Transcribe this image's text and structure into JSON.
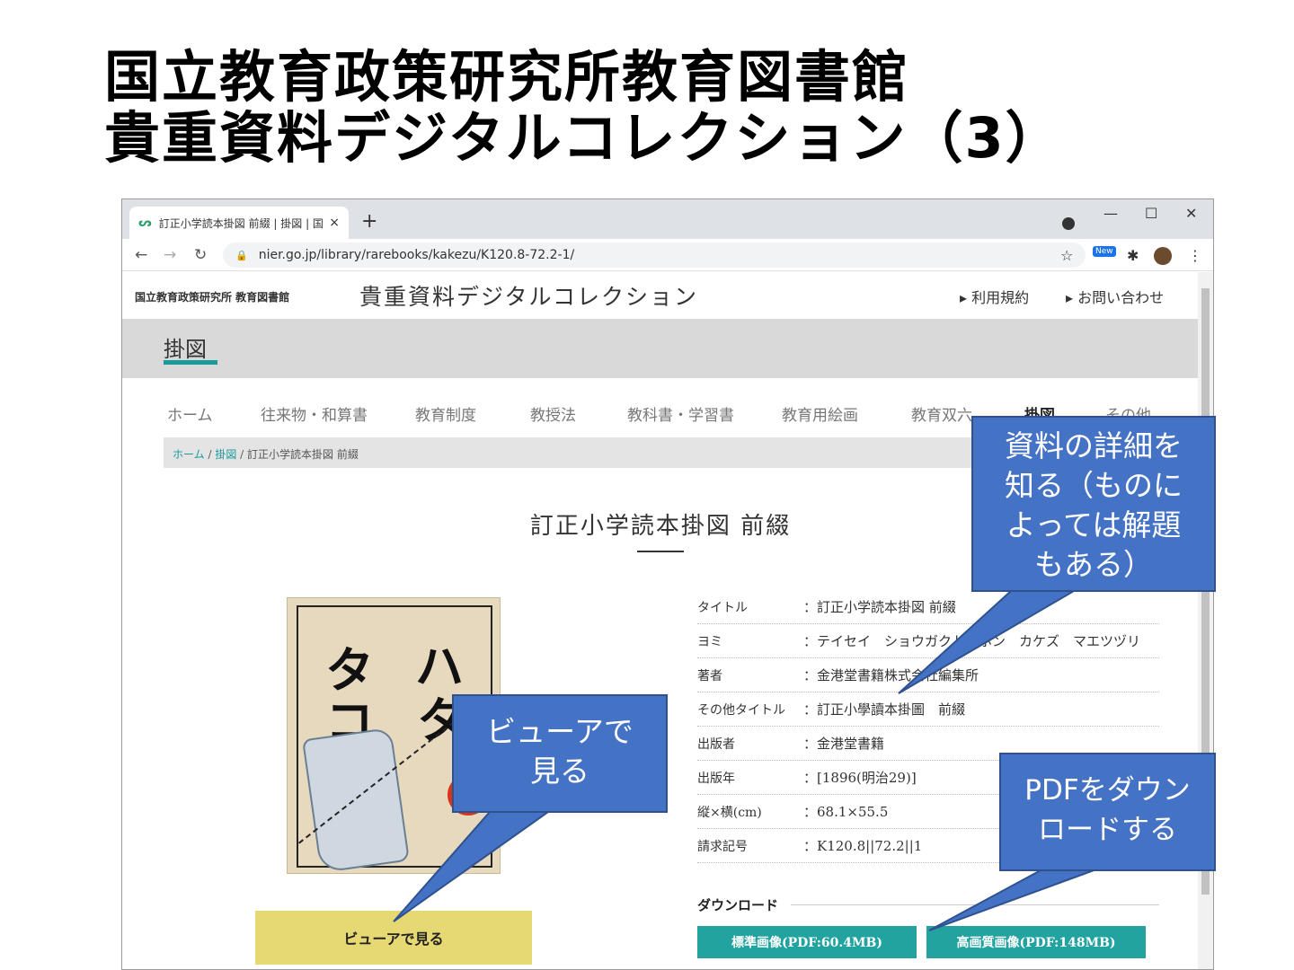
{
  "slide": {
    "title_line1": "国立教育政策研究所教育図書館",
    "title_line2": "貴重資料デジタルコレクション（3）"
  },
  "browser": {
    "tab_title": "訂正小学読本掛図 前綴 | 掛図 | 国",
    "tab_close": "×",
    "new_tab": "+",
    "url": "nier.go.jp/library/rarebooks/kakezu/K120.8-72.2-1/",
    "new_badge": "New"
  },
  "site": {
    "org": "国立教育政策研究所 教育図書館",
    "name": "貴重資料デジタルコレクション",
    "links": [
      "利用規約",
      "お問い合わせ"
    ],
    "section": "掛図",
    "nav": [
      "ホーム",
      "往来物・和算書",
      "教育制度",
      "教授法",
      "教科書・学習書",
      "教育用絵画",
      "教育双六",
      "掛図",
      "その他"
    ],
    "breadcrumb": {
      "home": "ホーム",
      "sep1": " / ",
      "section": "掛図",
      "sep2": " / ",
      "current": "訂正小学読本掛図 前綴"
    },
    "item_title": "訂正小学読本掛図 前綴",
    "thumbnail_kana": [
      "ハ",
      "タ",
      "タ",
      "コ"
    ],
    "viewer_button": "ビューアで見る",
    "metadata": [
      {
        "key": "タイトル",
        "value": "：訂正小学読本掛図 前綴"
      },
      {
        "key": "ヨミ",
        "value": "：テイセイ　ショウガクトクホン　カケズ　マエツヅリ"
      },
      {
        "key": "著者",
        "value": "：金港堂書籍株式会社編集所"
      },
      {
        "key": "その他タイトル",
        "value": "：訂正小學讀本掛圖　前綴"
      },
      {
        "key": "出版者",
        "value": "：金港堂書籍"
      },
      {
        "key": "出版年",
        "value": "：[1896(明治29)]"
      },
      {
        "key": "縦×横(cm)",
        "value": "：68.1×55.5"
      },
      {
        "key": "請求記号",
        "value": "：K120.8||72.2||1"
      }
    ],
    "download_heading": "ダウンロード",
    "download_standard": "標準画像(PDF:60.4MB)",
    "download_hq": "高画質画像(PDF:148MB)"
  },
  "callouts": {
    "details": [
      "資料の詳細を",
      "知る（ものに",
      "よっては解題",
      "もある）"
    ],
    "viewer": [
      "ビューアで",
      "見る"
    ],
    "pdf": [
      "PDFをダウン",
      "ロードする"
    ]
  },
  "colors": {
    "callout_fill": "#4472c4",
    "teal_accent": "#22a3a0",
    "viewer_button": "#e6d873",
    "section_band": "#d9d9d9"
  }
}
